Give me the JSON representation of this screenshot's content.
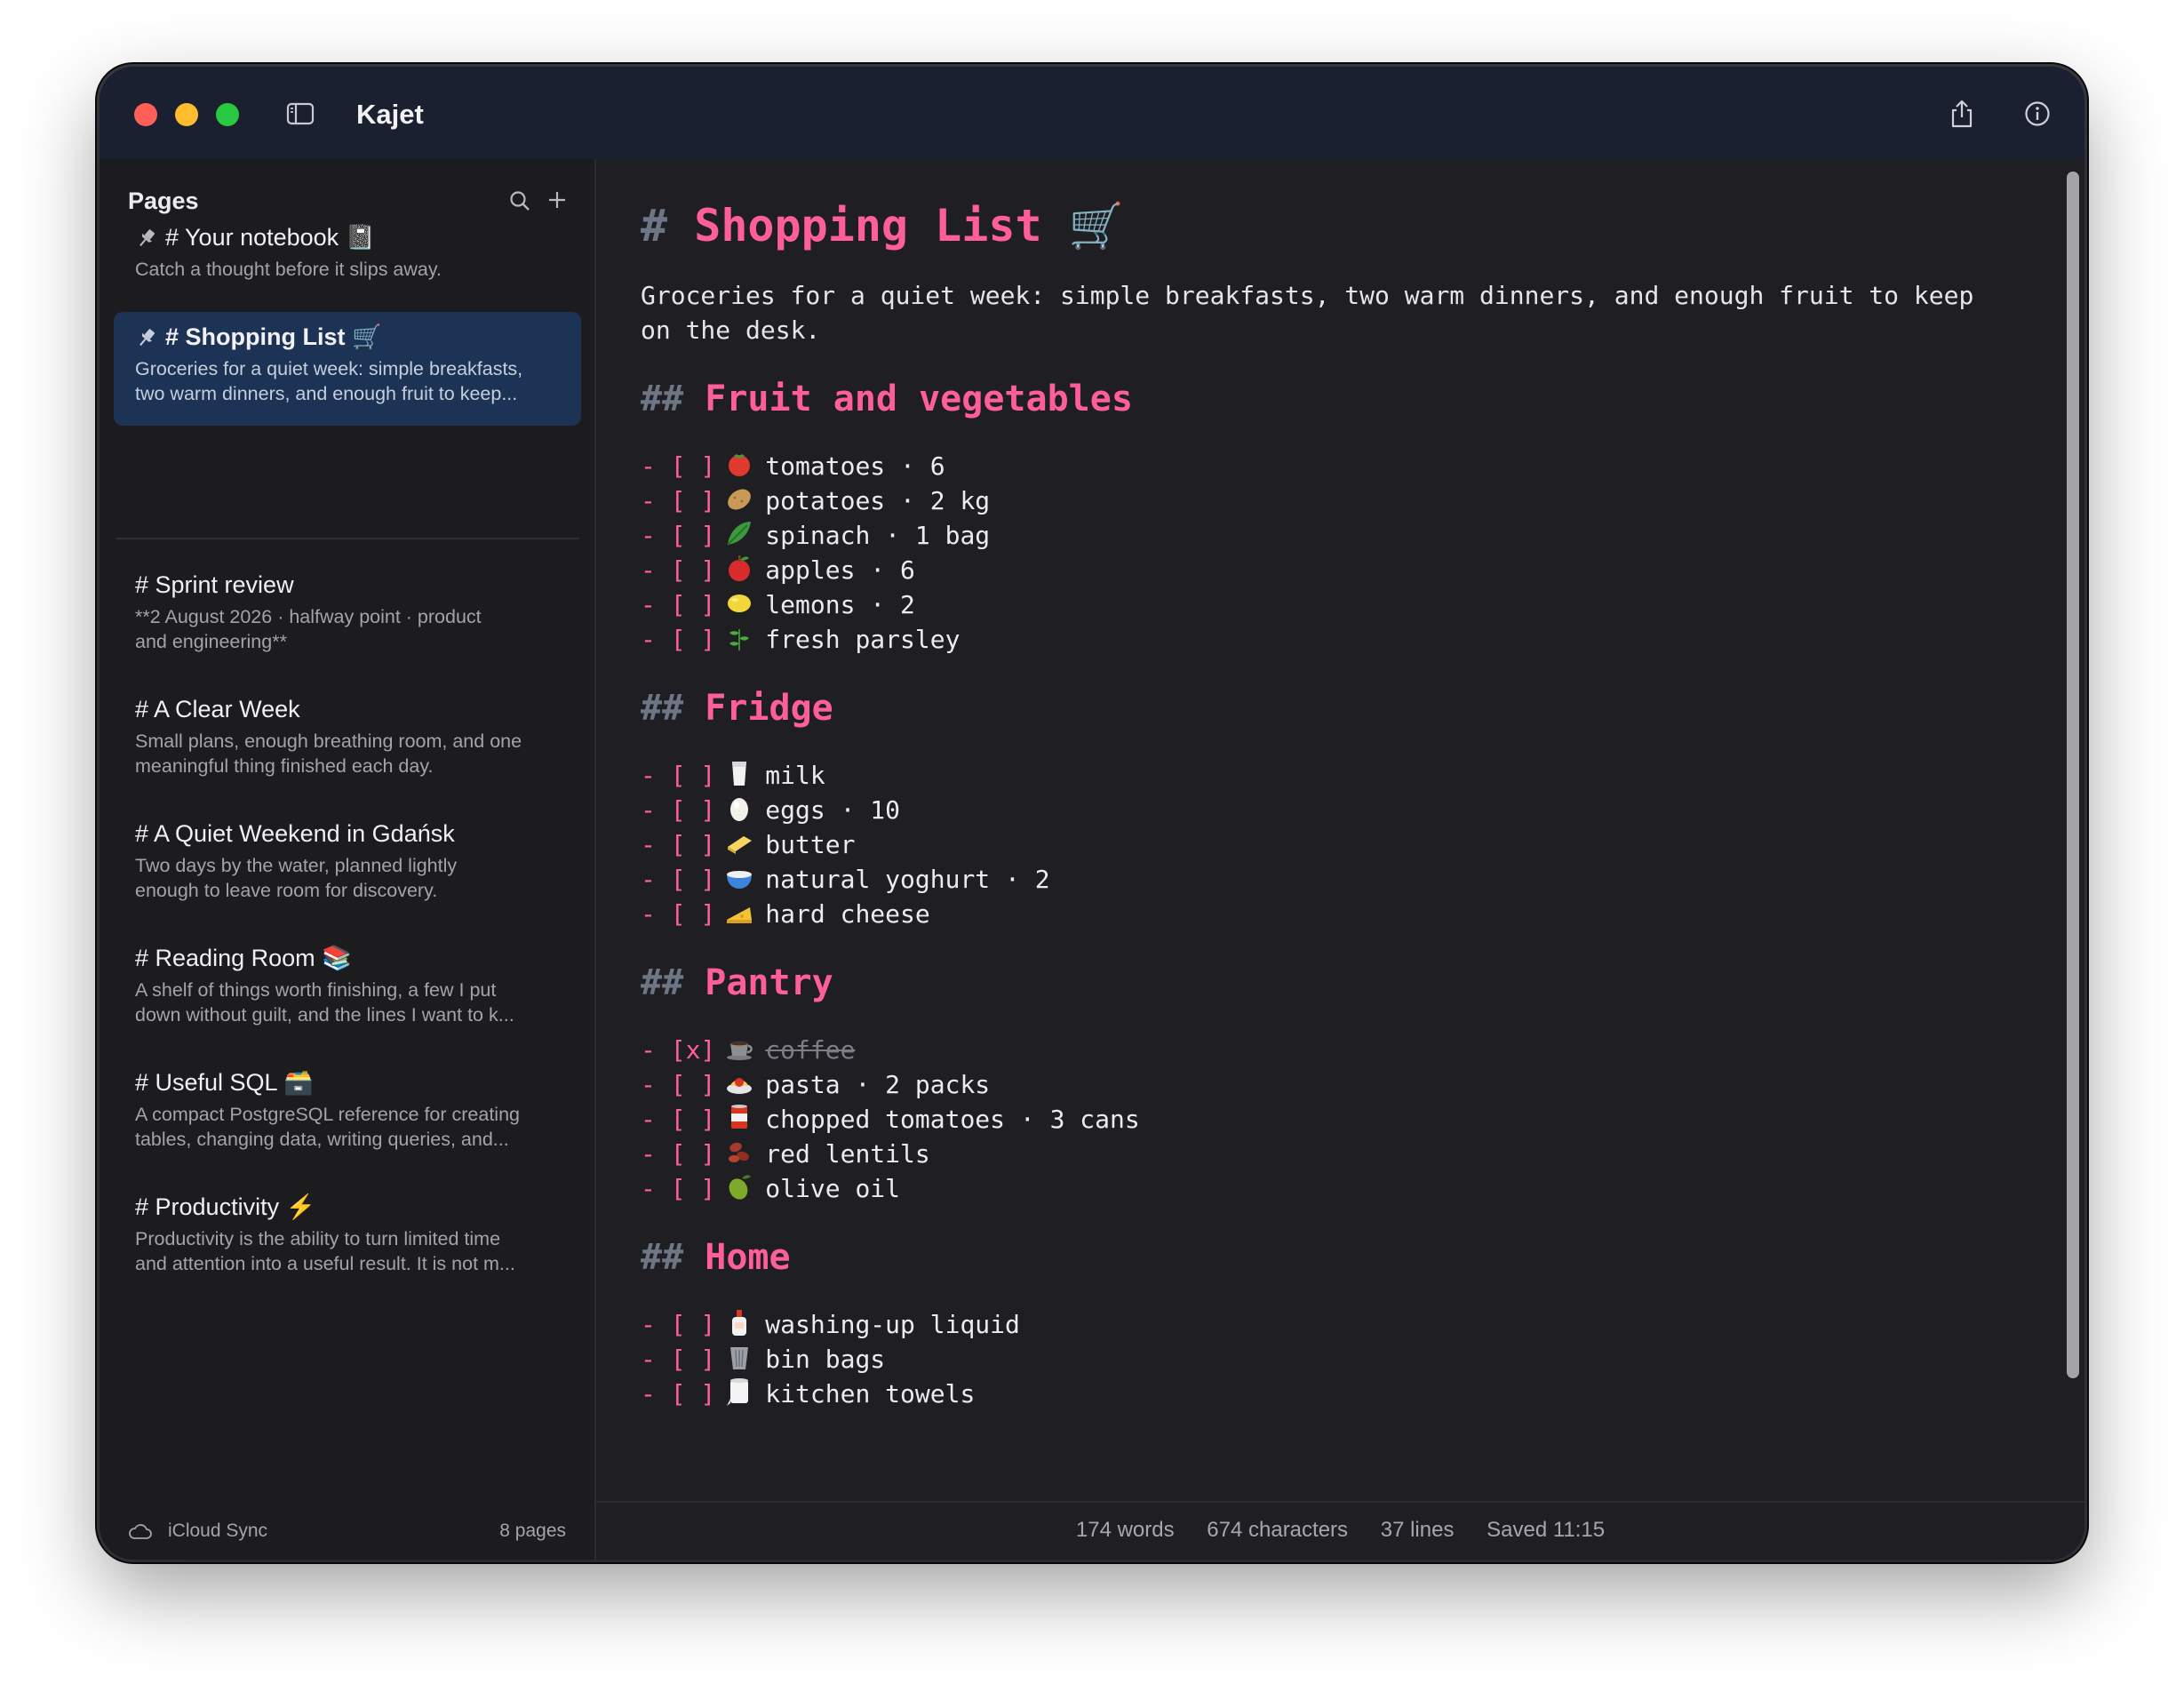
{
  "app": {
    "title": "Kajet"
  },
  "sidebar": {
    "header": "Pages",
    "pinned": [
      {
        "title": "# Your notebook 📓",
        "description": "Catch a thought before it slips away."
      },
      {
        "title": "# Shopping List 🛒",
        "description": "Groceries for a quiet week: simple breakfasts,\ntwo warm dinners, and enough fruit to keep..."
      }
    ],
    "pages": [
      {
        "title": "# Sprint review",
        "description": "**2 August 2026 · halfway point · product\nand engineering**"
      },
      {
        "title": "# A Clear Week",
        "description": "Small plans, enough breathing room, and one\nmeaningful thing finished each day."
      },
      {
        "title": "# A Quiet Weekend in Gdańsk",
        "description": "Two days by the water, planned lightly\nenough to leave room for discovery."
      },
      {
        "title": "# Reading Room 📚",
        "description": "A shelf of things worth finishing, a few I put\ndown without guilt, and the lines I want to k..."
      },
      {
        "title": "# Useful SQL 🗃️",
        "description": "A compact PostgreSQL reference for creating\ntables, changing data, writing queries, and..."
      },
      {
        "title": "# Productivity ⚡",
        "description": "Productivity is the ability to turn limited time\nand attention into a useful result. It is not m..."
      }
    ],
    "footer": {
      "sync": "iCloud Sync",
      "count": "8 pages"
    }
  },
  "document": {
    "title_hash": "#",
    "title": "Shopping List 🛒",
    "intro": "Groceries for a quiet week: simple breakfasts, two warm dinners, and enough fruit to keep on the desk.",
    "sections": [
      {
        "hash": "##",
        "heading": "Fruit and vegetables",
        "items": [
          {
            "marker": "- [ ]",
            "icon": "tomato",
            "text": "tomatoes · 6",
            "checked": false
          },
          {
            "marker": "- [ ]",
            "icon": "potato",
            "text": "potatoes · 2 kg",
            "checked": false
          },
          {
            "marker": "- [ ]",
            "icon": "leafy-greens",
            "text": "spinach · 1 bag",
            "checked": false
          },
          {
            "marker": "- [ ]",
            "icon": "apple",
            "text": "apples · 6",
            "checked": false
          },
          {
            "marker": "- [ ]",
            "icon": "lemon",
            "text": "lemons · 2",
            "checked": false
          },
          {
            "marker": "- [ ]",
            "icon": "herb",
            "text": "fresh parsley",
            "checked": false
          }
        ]
      },
      {
        "hash": "##",
        "heading": "Fridge",
        "items": [
          {
            "marker": "- [ ]",
            "icon": "milk-glass",
            "text": "milk",
            "checked": false
          },
          {
            "marker": "- [ ]",
            "icon": "egg",
            "text": "eggs · 10",
            "checked": false
          },
          {
            "marker": "- [ ]",
            "icon": "butter",
            "text": "butter",
            "checked": false
          },
          {
            "marker": "- [ ]",
            "icon": "bowl",
            "text": "natural yoghurt · 2",
            "checked": false
          },
          {
            "marker": "- [ ]",
            "icon": "cheese",
            "text": "hard cheese",
            "checked": false
          }
        ]
      },
      {
        "hash": "##",
        "heading": "Pantry",
        "items": [
          {
            "marker": "- [x]",
            "icon": "coffee-cup",
            "text": "coffee",
            "checked": true
          },
          {
            "marker": "- [ ]",
            "icon": "pasta",
            "text": "pasta · 2 packs",
            "checked": false
          },
          {
            "marker": "- [ ]",
            "icon": "can",
            "text": "chopped tomatoes · 3 cans",
            "checked": false
          },
          {
            "marker": "- [ ]",
            "icon": "beans",
            "text": "red lentils",
            "checked": false
          },
          {
            "marker": "- [ ]",
            "icon": "olive",
            "text": "olive oil",
            "checked": false
          }
        ]
      },
      {
        "hash": "##",
        "heading": "Home",
        "items": [
          {
            "marker": "- [ ]",
            "icon": "soap-bottle",
            "text": "washing-up liquid",
            "checked": false
          },
          {
            "marker": "- [ ]",
            "icon": "wastebasket",
            "text": "bin bags",
            "checked": false
          },
          {
            "marker": "- [ ]",
            "icon": "paper-towel",
            "text": "kitchen towels",
            "checked": false
          }
        ]
      }
    ]
  },
  "status": {
    "words": "174 words",
    "characters": "674 characters",
    "lines": "37 lines",
    "saved": "Saved 11:15"
  },
  "colors": {
    "accent": "#ff5e9c",
    "titlebar": "#1b2030",
    "sidebar_selected": "#1d3356",
    "editor_bg": "#1f1f23"
  }
}
